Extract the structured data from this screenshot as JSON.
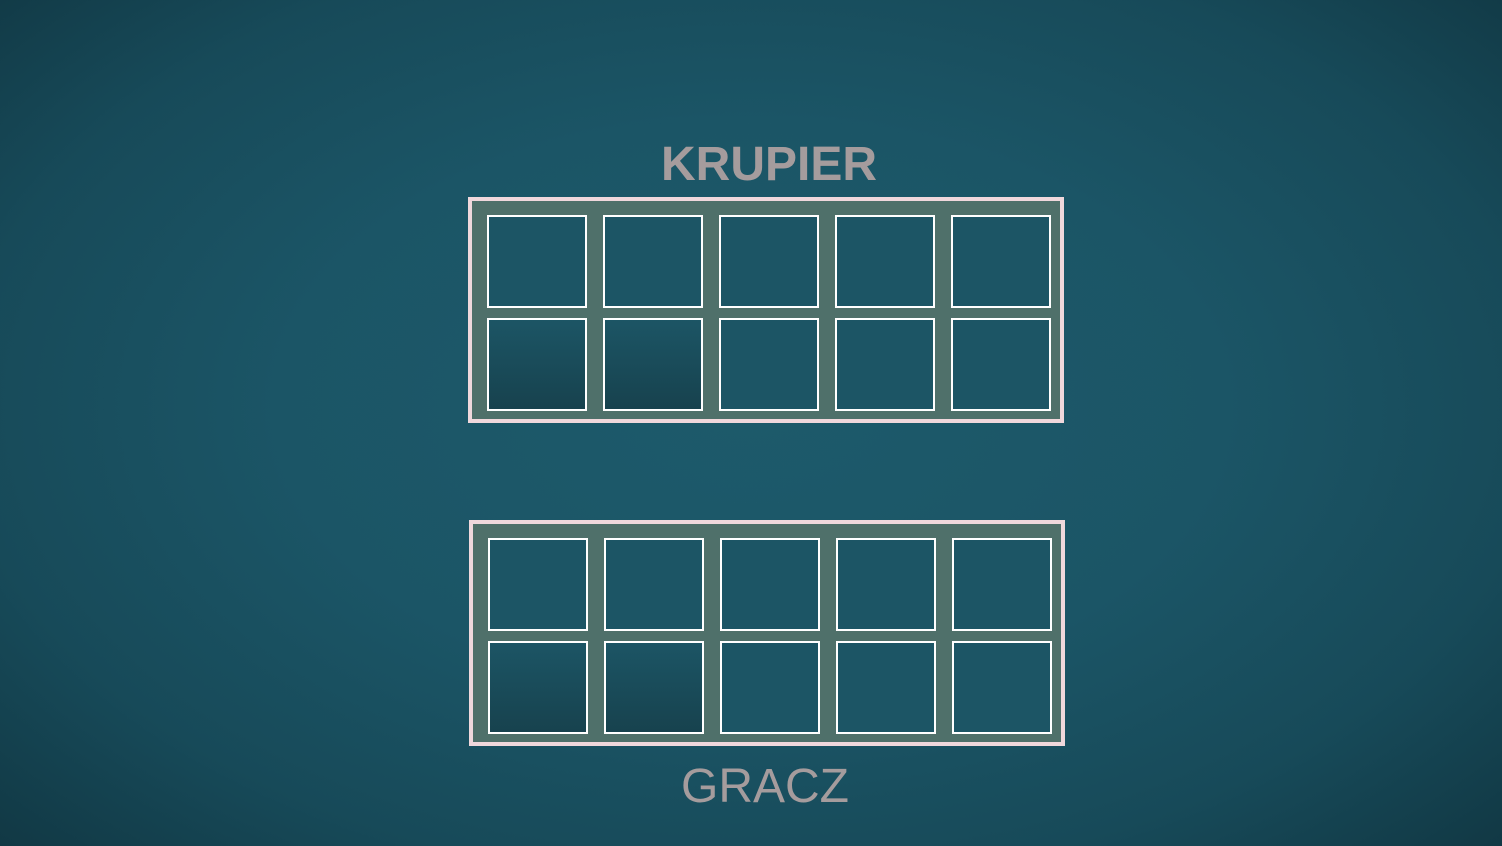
{
  "dealer": {
    "label": "KRUPIER",
    "card_slots": [
      {
        "row": 1,
        "col": 1
      },
      {
        "row": 1,
        "col": 2
      },
      {
        "row": 1,
        "col": 3
      },
      {
        "row": 1,
        "col": 4
      },
      {
        "row": 1,
        "col": 5
      },
      {
        "row": 2,
        "col": 1
      },
      {
        "row": 2,
        "col": 2
      },
      {
        "row": 2,
        "col": 3
      },
      {
        "row": 2,
        "col": 4
      },
      {
        "row": 2,
        "col": 5
      }
    ]
  },
  "player": {
    "label": "GRACZ",
    "card_slots": [
      {
        "row": 1,
        "col": 1
      },
      {
        "row": 1,
        "col": 2
      },
      {
        "row": 1,
        "col": 3
      },
      {
        "row": 1,
        "col": 4
      },
      {
        "row": 1,
        "col": 5
      },
      {
        "row": 2,
        "col": 1
      },
      {
        "row": 2,
        "col": 2
      },
      {
        "row": 2,
        "col": 3
      },
      {
        "row": 2,
        "col": 4
      },
      {
        "row": 2,
        "col": 5
      }
    ]
  },
  "colors": {
    "table": "#1b5566",
    "board_fill": "#4f706a",
    "board_border": "#f0d8dc",
    "slot_border": "#ffffff",
    "label_text": "#a59c9d"
  }
}
